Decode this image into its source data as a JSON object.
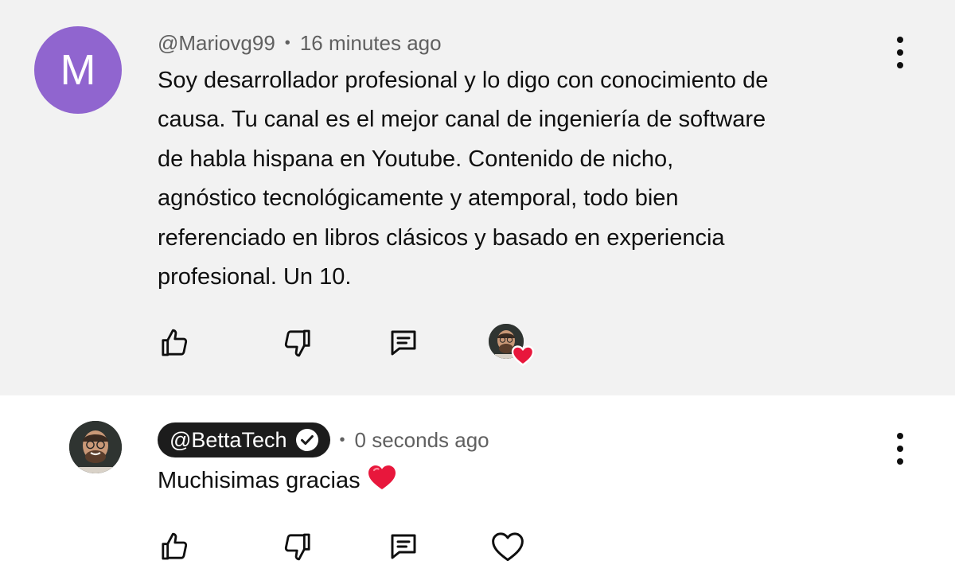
{
  "comments": [
    {
      "avatar_letter": "M",
      "avatar_color": "#9065cf",
      "handle": "@Mariovg99",
      "separator": "•",
      "time": "16 minutes ago",
      "lines": [
        "Soy desarrollador profesional y lo digo con conocimiento de",
        "causa. Tu canal es el mejor canal de ingeniería de software",
        "de habla hispana en Youtube. Contenido de nicho,",
        "agnóstico tecnológicamente y atemporal, todo bien",
        "referenciado en libros clásicos y basado en experiencia",
        "profesional. Un 10."
      ],
      "actions": [
        "thumbs-up-icon",
        "thumbs-down-icon",
        "reply-icon",
        "creator-heart-badge"
      ]
    },
    {
      "handle": "@BettaTech",
      "verified": true,
      "separator": "•",
      "time": "0 seconds ago",
      "text": "Muchisimas gracias",
      "emoji": "❤️",
      "actions": [
        "thumbs-up-icon",
        "thumbs-down-icon",
        "reply-icon",
        "heart-outline-icon"
      ]
    }
  ],
  "colors": {
    "highlight_bg": "#f2f2f2",
    "creator_chip_bg": "#1c1c1c",
    "heart_red": "#e8173c",
    "meta_gray": "#606060"
  }
}
